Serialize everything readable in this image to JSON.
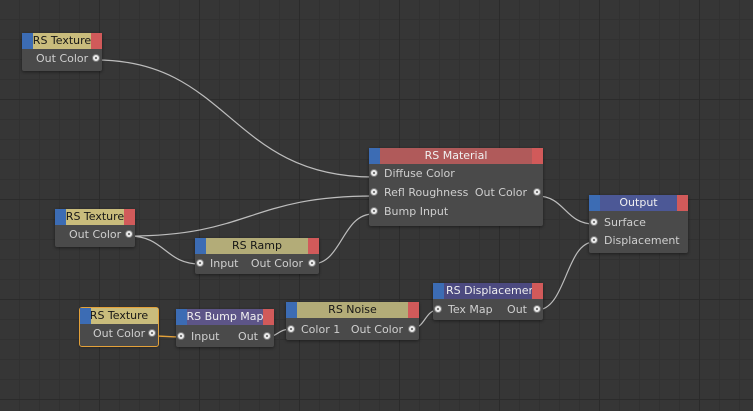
{
  "colors": {
    "canvas": "#363636",
    "node_body": "#4a4a4a",
    "header_texture": "#c9bc7c",
    "header_material": "#b05a5a",
    "header_ramp": "#b3ac78",
    "header_bump": "#5d5588",
    "header_noise": "#b3ac78",
    "header_displacement": "#4c4a80",
    "header_output": "#4c5896",
    "wire": "#bdbdbd",
    "selection": "#e3a13a"
  },
  "nodes": {
    "tex1": {
      "title": "RS Texture",
      "out": "Out Color"
    },
    "tex2": {
      "title": "RS Texture",
      "out": "Out Color"
    },
    "tex3": {
      "title": "RS Texture",
      "out": "Out Color"
    },
    "material": {
      "title": "RS Material",
      "in1": "Diffuse Color",
      "in2": "Refl Roughness",
      "in3": "Bump Input",
      "out": "Out Color"
    },
    "output": {
      "title": "Output",
      "in1": "Surface",
      "in2": "Displacement"
    },
    "ramp": {
      "title": "RS Ramp",
      "in": "Input",
      "out": "Out Color"
    },
    "bump": {
      "title": "RS Bump Map",
      "in": "Input",
      "out": "Out"
    },
    "noise": {
      "title": "RS Noise",
      "in": "Color 1",
      "out": "Out Color"
    },
    "displacement": {
      "title": "RS Displacement",
      "in": "Tex Map",
      "out": "Out"
    }
  }
}
